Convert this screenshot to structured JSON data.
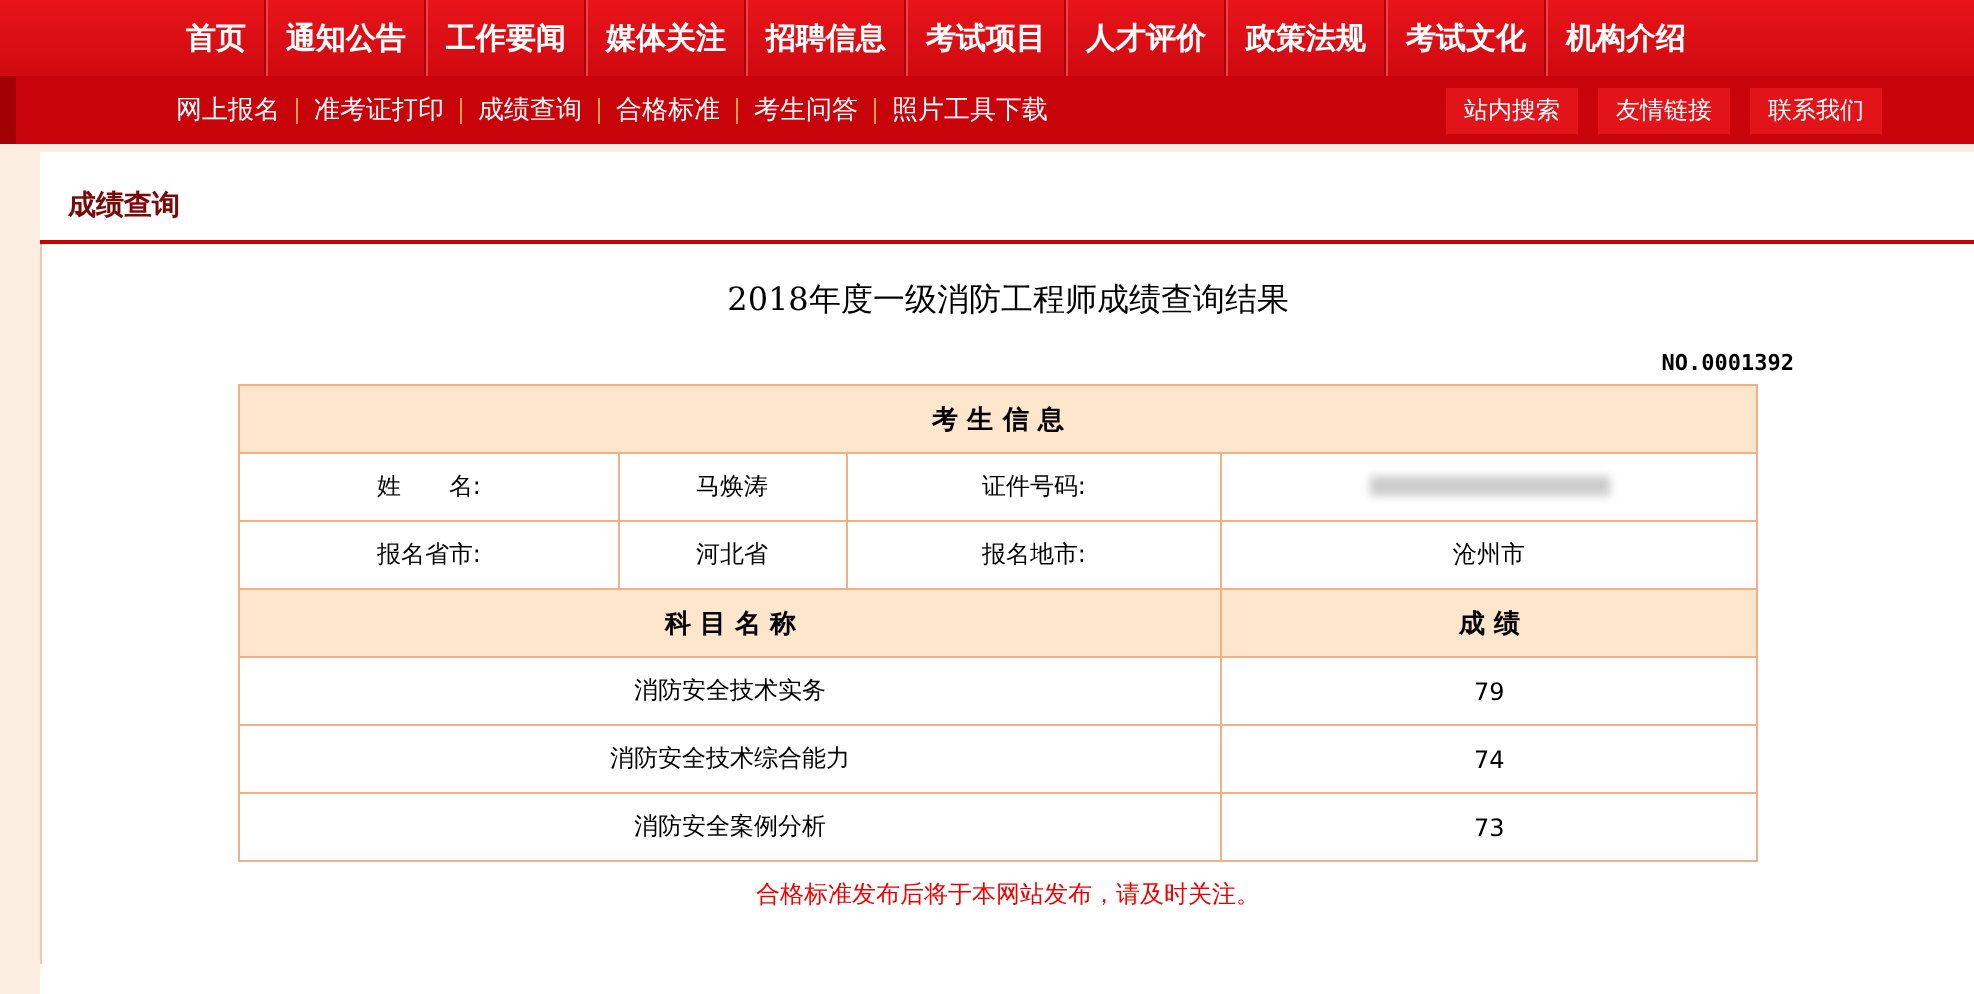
{
  "nav": {
    "items": [
      "首页",
      "通知公告",
      "工作要闻",
      "媒体关注",
      "招聘信息",
      "考试项目",
      "人才评价",
      "政策法规",
      "考试文化",
      "机构介绍"
    ]
  },
  "subnav": {
    "links": [
      "网上报名",
      "准考证打印",
      "成绩查询",
      "合格标准",
      "考生问答",
      "照片工具下载"
    ],
    "buttons": [
      "站内搜索",
      "友情链接",
      "联系我们"
    ]
  },
  "section_title": "成绩查询",
  "result": {
    "title": "2018年度一级消防工程师成绩查询结果",
    "serial": "NO.0001392",
    "info_header": "考 生 信 息",
    "info_rows": [
      [
        {
          "label": "姓　　名:",
          "value": "马焕涛",
          "redacted": false
        },
        {
          "label": "证件号码:",
          "redacted": true
        }
      ],
      [
        {
          "label": "报名省市:",
          "value": "河北省",
          "redacted": false
        },
        {
          "label": "报名地市:",
          "value": "沧州市",
          "redacted": false
        }
      ]
    ],
    "columns": [
      "科 目 名 称",
      "成 绩"
    ],
    "rows": [
      {
        "subject": "消防安全技术实务",
        "score": "79"
      },
      {
        "subject": "消防安全技术综合能力",
        "score": "74"
      },
      {
        "subject": "消防安全案例分析",
        "score": "73"
      }
    ],
    "note": "合格标准发布后将于本网站发布，请及时关注。"
  }
}
